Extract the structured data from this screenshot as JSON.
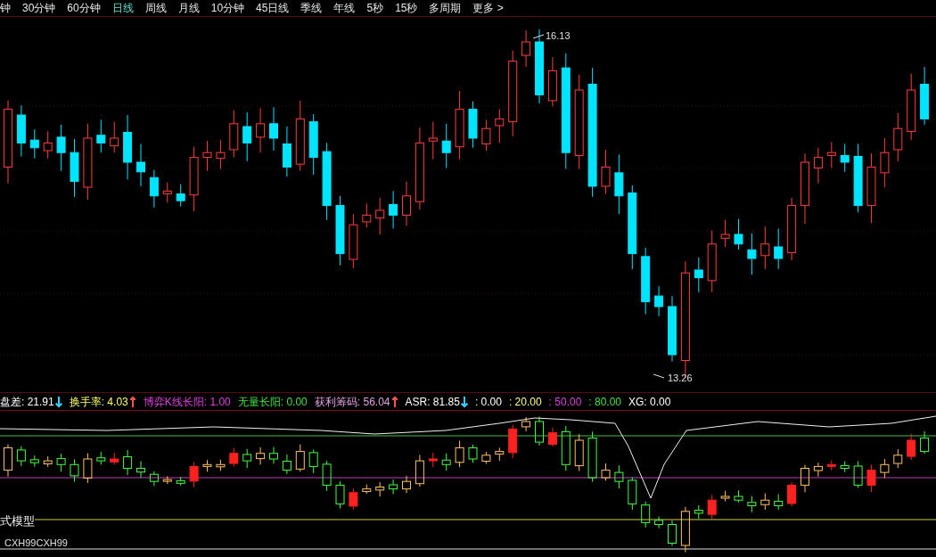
{
  "period_tabs": [
    {
      "label": "钟",
      "selected": false
    },
    {
      "label": "30分钟",
      "selected": false
    },
    {
      "label": "60分钟",
      "selected": false
    },
    {
      "label": "日线",
      "selected": true
    },
    {
      "label": "周线",
      "selected": false
    },
    {
      "label": "月线",
      "selected": false
    },
    {
      "label": "10分钟",
      "selected": false
    },
    {
      "label": "45日线",
      "selected": false
    },
    {
      "label": "季线",
      "selected": false
    },
    {
      "label": "年线",
      "selected": false
    },
    {
      "label": "5秒",
      "selected": false
    },
    {
      "label": "15秒",
      "selected": false
    },
    {
      "label": "多周期",
      "selected": false
    },
    {
      "label": "更多 >",
      "selected": false
    }
  ],
  "price_chart": {
    "high_label": "16.13",
    "low_label": "13.26"
  },
  "indicator_readouts": [
    {
      "label": "盘差:",
      "value": "21.91",
      "arrow": {
        "kind": "down",
        "color": "#33ccff"
      },
      "color": "#ffffff"
    },
    {
      "label": "换手率:",
      "value": "4.03",
      "arrow": {
        "kind": "up",
        "color": "#ff5050"
      },
      "color": "#ffff66"
    },
    {
      "label": "博弈K线长阳:",
      "value": "1.00",
      "color": "#e040e0"
    },
    {
      "label": "无量长阳:",
      "value": "0.00",
      "color": "#40e040"
    },
    {
      "label": "获利筹码:",
      "value": "56.04",
      "arrow": {
        "kind": "up",
        "color": "#ff5050"
      },
      "color": "#e0a0e0"
    },
    {
      "label": "ASR:",
      "value": "81.85",
      "arrow": {
        "kind": "down",
        "color": "#33ccff"
      },
      "color": "#ffffff"
    },
    {
      "label": ":",
      "value": "0.00",
      "color": "#ffffff"
    },
    {
      "label": ":",
      "value": "20.00",
      "color": "#ffff80"
    },
    {
      "label": ":",
      "value": "50.00",
      "color": "#e040e0"
    },
    {
      "label": ":",
      "value": "80.00",
      "color": "#40e040"
    },
    {
      "label": "XG:",
      "value": "0.00",
      "color": "#ffffff"
    }
  ],
  "indicator_panel": {
    "model_label": "式模型",
    "formula_label": "CXH99CXH99"
  }
}
